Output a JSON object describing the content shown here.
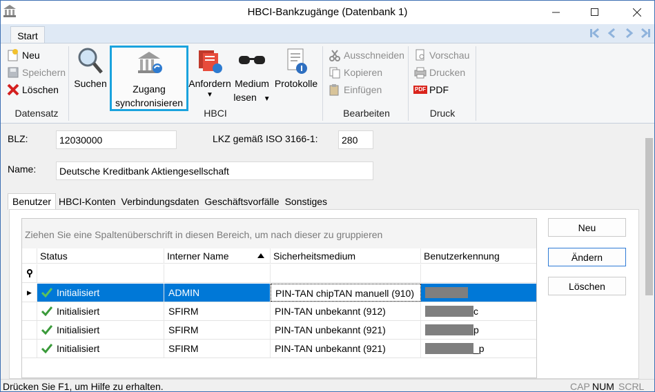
{
  "window": {
    "title": "HBCI-Bankzugänge (Datenbank 1)"
  },
  "ribbon": {
    "tab": "Start",
    "datensatz": {
      "label": "Datensatz",
      "neu": "Neu",
      "speichern": "Speichern",
      "loeschen": "Löschen"
    },
    "suchen": "Suchen",
    "hbci": {
      "label": "HBCI",
      "zugang_line1": "Zugang",
      "zugang_line2": "synchronisieren",
      "anfordern": "Anfordern",
      "medium_line1": "Medium",
      "medium_line2": "lesen",
      "protokolle": "Protokolle"
    },
    "bearbeiten": {
      "label": "Bearbeiten",
      "ausschneiden": "Ausschneiden",
      "kopieren": "Kopieren",
      "einfuegen": "Einfügen"
    },
    "druck": {
      "label": "Druck",
      "vorschau": "Vorschau",
      "drucken": "Drucken",
      "pdf": "PDF",
      "pdf_icon": "PDF"
    }
  },
  "form": {
    "blz_label": "BLZ:",
    "blz_value": "12030000",
    "lkz_label": "LKZ gemäß ISO 3166-1:",
    "lkz_value": "280",
    "name_label": "Name:",
    "name_value": "Deutsche Kreditbank Aktiengesellschaft"
  },
  "tabs": [
    "Benutzer",
    "HBCI-Konten",
    "Verbindungsdaten",
    "Geschäftsvorfälle",
    "Sonstiges"
  ],
  "grid": {
    "group_hint": "Ziehen Sie eine Spaltenüberschrift in diesen Bereich, um nach dieser zu gruppieren",
    "columns": [
      "Status",
      "Interner Name",
      "Sicherheitsmedium",
      "Benutzerkennung"
    ],
    "rows": [
      {
        "status": "Initialisiert",
        "name": "ADMIN",
        "medium": "PIN-TAN chipTAN manuell (910)",
        "kennung_suffix": ""
      },
      {
        "status": "Initialisiert",
        "name": "SFIRM",
        "medium": "PIN-TAN unbekannt (912)",
        "kennung_suffix": "c"
      },
      {
        "status": "Initialisiert",
        "name": "SFIRM",
        "medium": "PIN-TAN unbekannt (921)",
        "kennung_suffix": "p"
      },
      {
        "status": "Initialisiert",
        "name": "SFIRM",
        "medium": "PIN-TAN unbekannt (921)",
        "kennung_suffix": "_p"
      }
    ]
  },
  "buttons": {
    "neu": "Neu",
    "aendern": "Ändern",
    "loeschen": "Löschen"
  },
  "statusbar": {
    "text": "Drücken Sie F1, um Hilfe zu erhalten.",
    "cap": "CAP",
    "num": "NUM",
    "scrl": "SCRL"
  },
  "colors": {
    "accent": "#1aa3de",
    "selection": "#0078d7",
    "check": "#3a9a3a"
  }
}
